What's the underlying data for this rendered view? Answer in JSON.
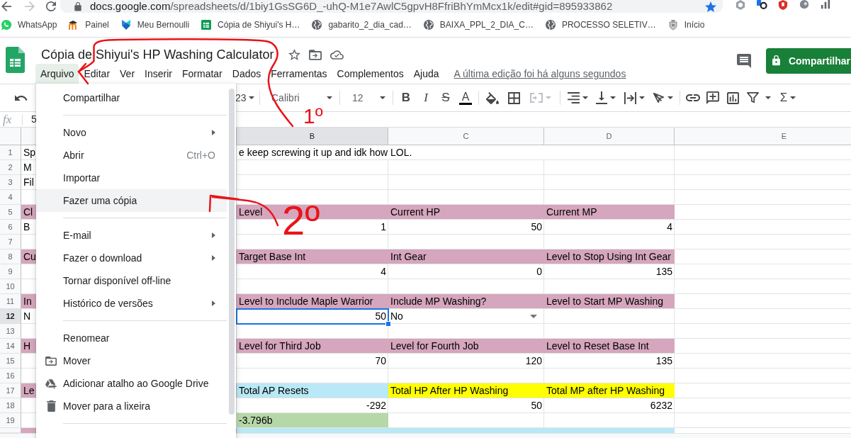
{
  "browser": {
    "url_host": "docs.google.com",
    "url_path": "/spreadsheets/d/1biy1GsSG6D_-uhQ-M1e7AwlC5gpvH8FfriBhYmMcx1k/edit#gid=895933862",
    "bookmarked": true,
    "bookmarks": [
      {
        "label": "WhatsApp"
      },
      {
        "label": "Painel"
      },
      {
        "label": "Meu Bernoulli"
      },
      {
        "label": "Cópia de Shiyui's H…"
      },
      {
        "label": "gabarito_2_dia_cad…"
      },
      {
        "label": "BAIXA_PPL_2_DIA_C…"
      },
      {
        "label": "PROCESSO SELETIV…"
      },
      {
        "label": "Início"
      }
    ]
  },
  "app": {
    "title": "Cópia de Shiyui's HP Washing Calculator",
    "menubar": [
      {
        "label": "Arquivo",
        "selected": true
      },
      {
        "label": "Editar",
        "selected": false
      },
      {
        "label": "Ver",
        "selected": false
      },
      {
        "label": "Inserir",
        "selected": false
      },
      {
        "label": "Formatar",
        "selected": false
      },
      {
        "label": "Dados",
        "selected": false
      },
      {
        "label": "Ferramentas",
        "selected": false
      },
      {
        "label": "Complementos",
        "selected": false
      },
      {
        "label": "Ajuda",
        "selected": false
      }
    ],
    "last_edit": "A última edição foi há alguns segundos",
    "share_button": "Compartilhar"
  },
  "toolbar": {
    "format": "23",
    "font": "Calibri",
    "font_size": "12",
    "bold": "B",
    "italic": "I",
    "strikethrough": "S",
    "text_color": "A",
    "merge_disabled": true,
    "functions": "Σ"
  },
  "formula_bar": {
    "label": "fx",
    "value": "5"
  },
  "sheet": {
    "columns": [
      {
        "selected": false
      },
      {
        "label": "B",
        "selected": true
      },
      {
        "label": "C",
        "selected": false
      },
      {
        "label": "D",
        "selected": false
      },
      {
        "label": "E",
        "selected": false
      }
    ],
    "rows": [
      {
        "number": "1",
        "selected": false,
        "cells": [
          {
            "text": "Sp",
            "kind": "text"
          },
          {
            "text": "e keep screwing it up and idk how LOL.",
            "kind": "overflow"
          }
        ]
      },
      {
        "number": "2",
        "selected": false,
        "cells": [
          {
            "text": "M",
            "kind": "text"
          }
        ]
      },
      {
        "number": "3",
        "selected": false,
        "cells": [
          {
            "text": "Fil",
            "kind": "text"
          }
        ]
      },
      {
        "number": "4",
        "selected": false
      },
      {
        "number": "5",
        "selected": false,
        "cells": [
          {
            "text": "Cl",
            "kind": "text",
            "color": "#d5a6bd"
          },
          {
            "text": "Level",
            "kind": "text",
            "color": "#d5a6bd"
          },
          {
            "text": "Current HP",
            "kind": "text",
            "color": "#d5a6bd"
          },
          {
            "text": "Current MP",
            "kind": "text",
            "color": "#d5a6bd"
          }
        ]
      },
      {
        "number": "6",
        "selected": false,
        "cells": [
          {
            "text": "B",
            "kind": "text"
          },
          {
            "text": "1",
            "kind": "number"
          },
          {
            "text": "50",
            "kind": "number"
          },
          {
            "text": "4",
            "kind": "number"
          }
        ]
      },
      {
        "number": "7",
        "selected": false
      },
      {
        "number": "8",
        "selected": false,
        "cells": [
          {
            "text": "Cu",
            "kind": "text",
            "color": "#d5a6bd"
          },
          {
            "text": "Target Base Int",
            "kind": "text",
            "color": "#d5a6bd"
          },
          {
            "text": "Int Gear",
            "kind": "text",
            "color": "#d5a6bd"
          },
          {
            "text": "Level to Stop Using Int Gear",
            "kind": "text",
            "color": "#d5a6bd"
          }
        ]
      },
      {
        "number": "9",
        "selected": false,
        "cells": [
          {},
          {
            "text": "4",
            "kind": "number"
          },
          {
            "text": "0",
            "kind": "number"
          },
          {
            "text": "135",
            "kind": "number"
          }
        ]
      },
      {
        "number": "10",
        "selected": false
      },
      {
        "number": "11",
        "selected": false,
        "cells": [
          {
            "text": "In",
            "kind": "text",
            "color": "#d5a6bd"
          },
          {
            "text": "Level to Include Maple Warrior",
            "kind": "text",
            "color": "#d5a6bd"
          },
          {
            "text": "Include MP Washing?",
            "kind": "text",
            "color": "#d5a6bd"
          },
          {
            "text": "Level to Start MP Washing",
            "kind": "text",
            "color": "#d5a6bd"
          }
        ]
      },
      {
        "number": "12",
        "selected": true,
        "cells": [
          {
            "text": "N",
            "kind": "text"
          },
          {
            "text": "50",
            "kind": "number"
          },
          {
            "text": "No",
            "kind": "dropdown"
          }
        ]
      },
      {
        "number": "13",
        "selected": false
      },
      {
        "number": "14",
        "selected": false,
        "cells": [
          {
            "text": "H",
            "kind": "text",
            "color": "#d5a6bd"
          },
          {
            "text": "Level for Third Job",
            "kind": "text",
            "color": "#d5a6bd"
          },
          {
            "text": "Level for Fourth Job",
            "kind": "text",
            "color": "#d5a6bd"
          },
          {
            "text": "Level to Reset Base Int",
            "kind": "text",
            "color": "#d5a6bd"
          }
        ]
      },
      {
        "number": "15",
        "selected": false,
        "cells": [
          {},
          {
            "text": "70",
            "kind": "number"
          },
          {
            "text": "120",
            "kind": "number"
          },
          {
            "text": "135",
            "kind": "number"
          }
        ]
      },
      {
        "number": "16",
        "selected": false
      },
      {
        "number": "17",
        "selected": false,
        "cells": [
          {
            "text": "Le",
            "kind": "text",
            "color": "#d5a6bd"
          },
          {
            "text": "Total AP Resets",
            "kind": "text",
            "color": "#b9e8f6"
          },
          {
            "text": "Total HP After HP Washing",
            "kind": "text",
            "color": "#ffff00"
          },
          {
            "text": "Total MP after HP Washing",
            "kind": "text",
            "color": "#ffff00"
          }
        ]
      },
      {
        "number": "18",
        "selected": false,
        "cells": [
          {},
          {
            "text": "-292",
            "kind": "number"
          },
          {
            "text": "50",
            "kind": "number"
          },
          {
            "text": "6232",
            "kind": "number"
          }
        ]
      },
      {
        "number": "19",
        "selected": false,
        "cells": [
          {},
          {
            "text": "-3.796b",
            "kind": "text",
            "color": "#b6d7a8"
          }
        ]
      },
      {
        "selected": false,
        "cells": [
          {
            "color": "#d5a6bd"
          },
          {
            "color": "#b9e8f6"
          },
          {
            "color": "#b9e8f6"
          },
          {
            "color": "#b9e8f6"
          }
        ]
      }
    ]
  },
  "file_menu": {
    "sections": [
      [
        {
          "label": "Compartilhar",
          "submenu": false,
          "selected": false
        }
      ],
      [
        {
          "label": "Novo",
          "submenu": true,
          "selected": false
        },
        {
          "label": "Abrir",
          "shortcut": "Ctrl+O",
          "submenu": false,
          "selected": false
        },
        {
          "label": "Importar",
          "submenu": false,
          "selected": false
        },
        {
          "label": "Fazer uma cópia",
          "submenu": false,
          "selected": true
        }
      ],
      [
        {
          "label": "E-mail",
          "submenu": true,
          "selected": false
        },
        {
          "label": "Fazer o download",
          "submenu": true,
          "selected": false
        },
        {
          "label": "Tornar disponível off-line",
          "submenu": false,
          "selected": false
        },
        {
          "label": "Histórico de versões",
          "submenu": true,
          "selected": false
        }
      ],
      [
        {
          "label": "Renomear",
          "submenu": false,
          "selected": false
        },
        {
          "label": "Mover",
          "submenu": false,
          "selected": false
        },
        {
          "label": "Adicionar atalho ao Google Drive",
          "submenu": false,
          "selected": false
        },
        {
          "label": "Mover para a lixeira",
          "submenu": false,
          "selected": false
        }
      ]
    ]
  },
  "annotations": [
    {
      "text": "1º"
    },
    {
      "text": "2º"
    }
  ]
}
